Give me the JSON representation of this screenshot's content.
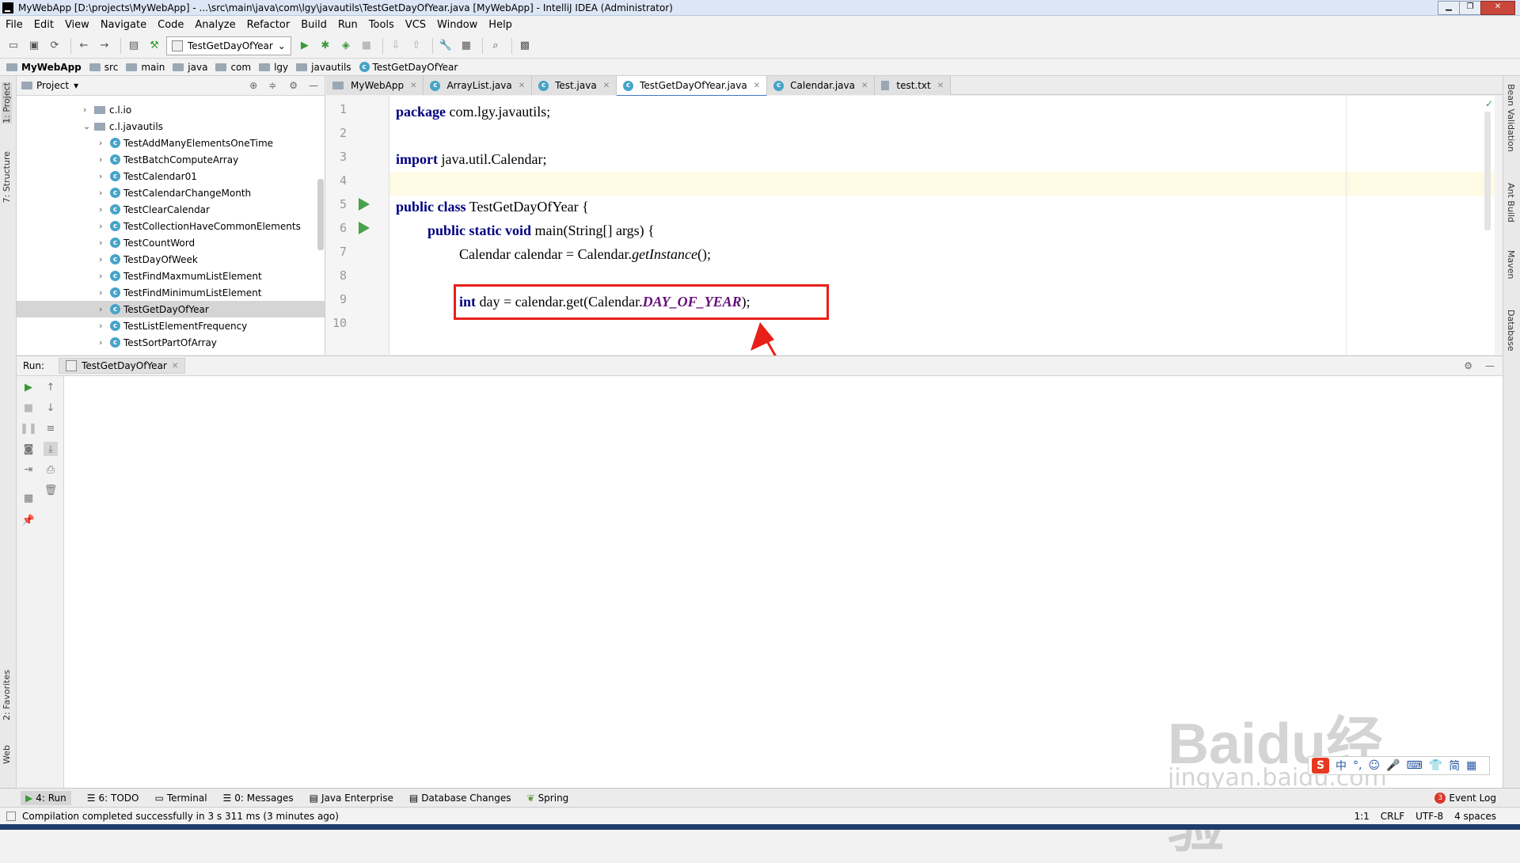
{
  "window": {
    "title": "MyWebApp [D:\\projects\\MyWebApp] - ...\\src\\main\\java\\com\\lgy\\javautils\\TestGetDayOfYear.java [MyWebApp] - IntelliJ IDEA (Administrator)"
  },
  "menu": [
    "File",
    "Edit",
    "View",
    "Navigate",
    "Code",
    "Analyze",
    "Refactor",
    "Build",
    "Run",
    "Tools",
    "VCS",
    "Window",
    "Help"
  ],
  "toolbar": {
    "run_config": "TestGetDayOfYear"
  },
  "breadcrumb": [
    "MyWebApp",
    "src",
    "main",
    "java",
    "com",
    "lgy",
    "javautils",
    "TestGetDayOfYear"
  ],
  "left_strip": [
    "1: Project",
    "7: Structure",
    "2: Favorites",
    "Web"
  ],
  "right_strip": [
    "Bean Validation",
    "Ant Build",
    "Maven",
    "Database"
  ],
  "project": {
    "header": "Project",
    "tree": [
      {
        "label": "c.l.io",
        "kind": "package",
        "expanded": false
      },
      {
        "label": "c.l.javautils",
        "kind": "package",
        "expanded": true
      },
      {
        "label": "TestAddManyElementsOneTime",
        "kind": "class"
      },
      {
        "label": "TestBatchComputeArray",
        "kind": "class"
      },
      {
        "label": "TestCalendar01",
        "kind": "class"
      },
      {
        "label": "TestCalendarChangeMonth",
        "kind": "class"
      },
      {
        "label": "TestClearCalendar",
        "kind": "class"
      },
      {
        "label": "TestCollectionHaveCommonElements",
        "kind": "class"
      },
      {
        "label": "TestCountWord",
        "kind": "class"
      },
      {
        "label": "TestDayOfWeek",
        "kind": "class"
      },
      {
        "label": "TestFindMaxmumListElement",
        "kind": "class"
      },
      {
        "label": "TestFindMinimumListElement",
        "kind": "class"
      },
      {
        "label": "TestGetDayOfYear",
        "kind": "class",
        "selected": true
      },
      {
        "label": "TestListElementFrequency",
        "kind": "class"
      },
      {
        "label": "TestSortPartOfArray",
        "kind": "class"
      }
    ]
  },
  "editor": {
    "tabs": [
      {
        "label": "MyWebApp",
        "active": false
      },
      {
        "label": "ArrayList.java",
        "active": false
      },
      {
        "label": "Test.java",
        "active": false
      },
      {
        "label": "TestGetDayOfYear.java",
        "active": true
      },
      {
        "label": "Calendar.java",
        "active": false
      },
      {
        "label": "test.txt",
        "active": false
      }
    ],
    "line_numbers": [
      "1",
      "2",
      "3",
      "4",
      "5",
      "6",
      "7",
      "8",
      "9",
      "10"
    ],
    "code": {
      "l1_kw": "package",
      "l1_rest": " com.lgy.javautils;",
      "l3_kw": "import",
      "l3_rest": " java.util.Calendar;",
      "l5_kw": "public class",
      "l5_rest": " TestGetDayOfYear {",
      "l6_kw": "public static void",
      "l6_rest": " main(String[] args) {",
      "l7_a": "Calendar calendar = Calendar.",
      "l7_it": "getInstance",
      "l7_b": "();",
      "l9_kw": "int",
      "l9_a": " day = calendar.get(Calendar.",
      "l9_const": "DAY_OF_YEAR",
      "l9_b": ");"
    }
  },
  "run": {
    "label": "Run:",
    "tab": "TestGetDayOfYear"
  },
  "bottom_tabs": [
    "4: Run",
    "6: TODO",
    "Terminal",
    "0: Messages",
    "Java Enterprise",
    "Database Changes",
    "Spring"
  ],
  "event_log": {
    "count": "3",
    "label": "Event Log"
  },
  "status": {
    "message": "Compilation completed successfully in 3 s 311 ms (3 minutes ago)",
    "position": "1:1",
    "line_sep": "CRLF",
    "encoding": "UTF-8",
    "indent": "4 spaces"
  },
  "watermark": {
    "brand": "Baidu经验",
    "url": "jingyan.baidu.com"
  },
  "ime": {
    "items": [
      "中",
      "°,",
      "☺",
      "简"
    ]
  },
  "colors": {
    "highlight_box": "#e8201a",
    "keyword": "#000080",
    "constant": "#660e7a",
    "run_green": "#4aa04a"
  }
}
